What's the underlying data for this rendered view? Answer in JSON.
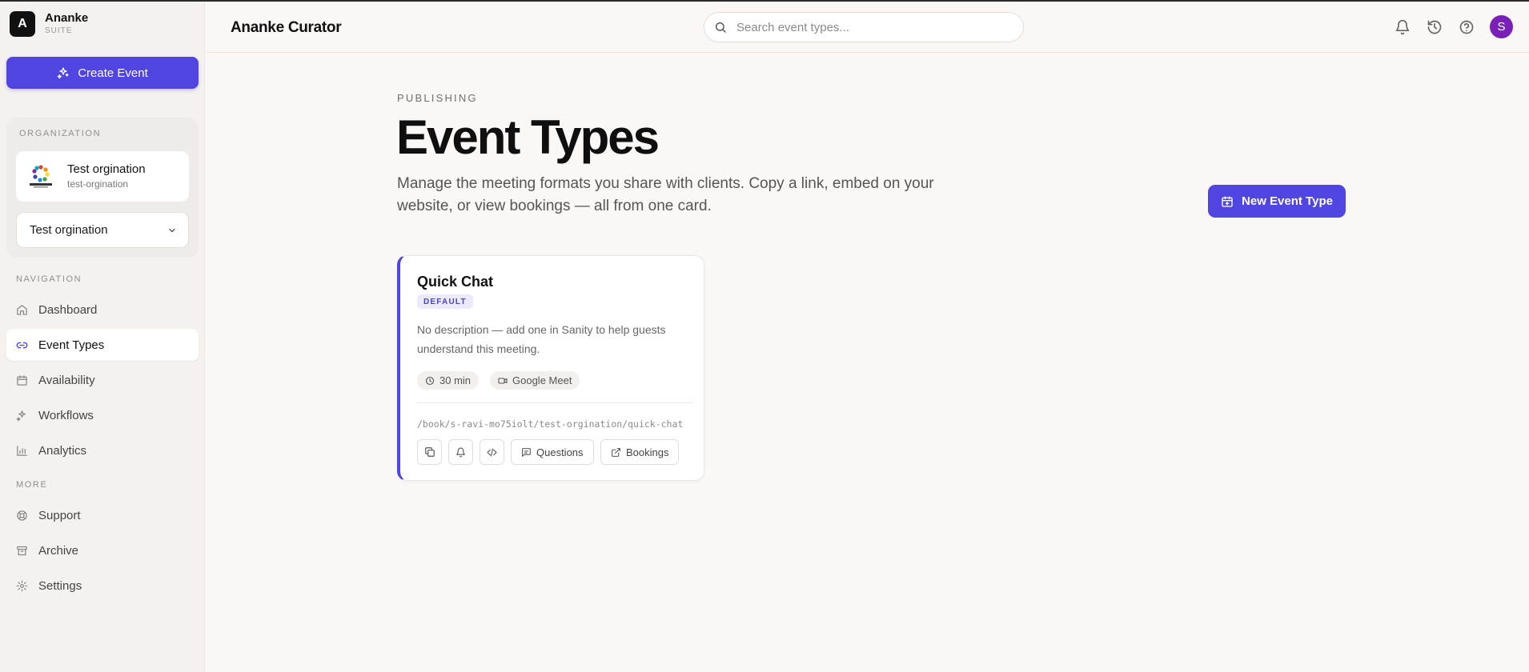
{
  "brand": {
    "logo_letter": "A",
    "name": "Ananke",
    "sub": "SUITE"
  },
  "sidebar": {
    "create_label": "Create Event",
    "org_section_label": "ORGANIZATION",
    "org": {
      "name": "Test orgination",
      "slug": "test-orgination",
      "logo_caption": "Organization"
    },
    "org_select_value": "Test orgination",
    "nav_label": "NAVIGATION",
    "nav_items": [
      {
        "label": "Dashboard",
        "icon": "home-icon"
      },
      {
        "label": "Event Types",
        "icon": "link-icon",
        "active": true
      },
      {
        "label": "Availability",
        "icon": "calendar-icon"
      },
      {
        "label": "Workflows",
        "icon": "sparkles-icon"
      },
      {
        "label": "Analytics",
        "icon": "bar-chart-icon"
      }
    ],
    "more_label": "MORE",
    "more_items": [
      {
        "label": "Support",
        "icon": "lifebuoy-icon"
      },
      {
        "label": "Archive",
        "icon": "archive-icon"
      },
      {
        "label": "Settings",
        "icon": "gear-icon"
      }
    ]
  },
  "header": {
    "title": "Ananke Curator",
    "search_placeholder": "Search event types...",
    "avatar_letter": "S"
  },
  "main": {
    "eyebrow": "PUBLISHING",
    "title": "Event Types",
    "subtitle": "Manage the meeting formats you share with clients. Copy a link, embed on your website, or view bookings — all from one card.",
    "new_button_label": "New Event Type"
  },
  "card": {
    "title": "Quick Chat",
    "badge": "DEFAULT",
    "description": "No description — add one in Sanity to help guests understand this meeting.",
    "duration": "30 min",
    "location": "Google Meet",
    "link": "/book/s-ravi-mo75iolt/test-orgination/quick-chat",
    "questions_label": "Questions",
    "bookings_label": "Bookings"
  },
  "colors": {
    "accent": "#5045e0",
    "avatar": "#7a1fb8",
    "background": "#faf7f5",
    "sidebar": "#f4f1ef"
  }
}
